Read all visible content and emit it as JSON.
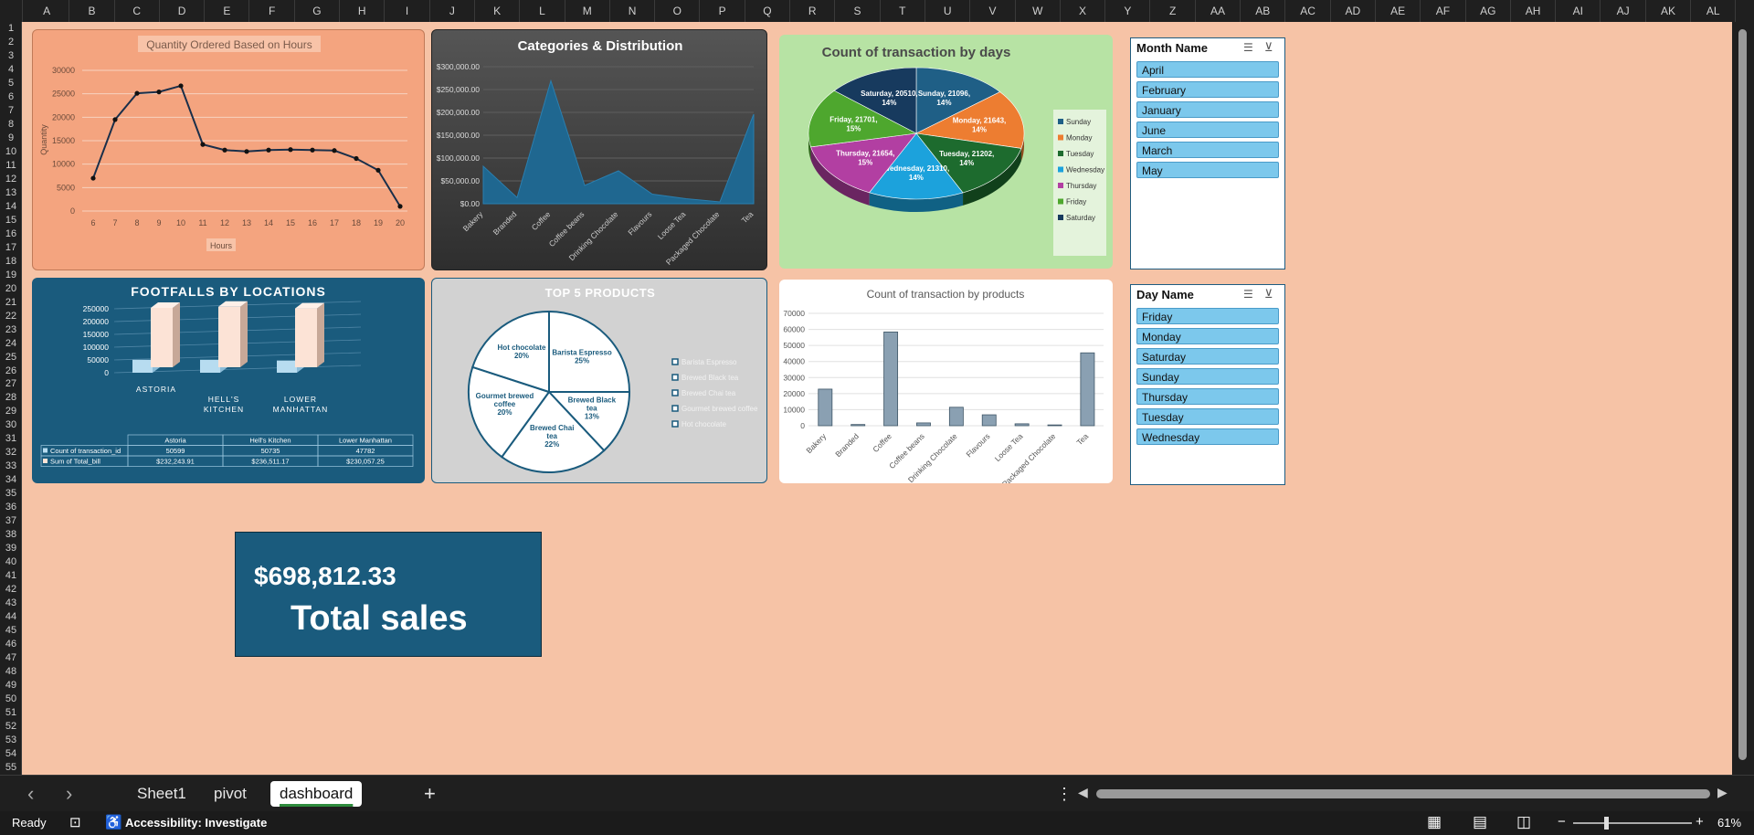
{
  "columns": [
    "A",
    "B",
    "C",
    "D",
    "E",
    "F",
    "G",
    "H",
    "I",
    "J",
    "K",
    "L",
    "M",
    "N",
    "O",
    "P",
    "Q",
    "R",
    "S",
    "T",
    "U",
    "V",
    "W",
    "X",
    "Y",
    "Z",
    "AA",
    "AB",
    "AC",
    "AD",
    "AE",
    "AF",
    "AG",
    "AH",
    "AI",
    "AJ",
    "AK",
    "AL"
  ],
  "rows": [
    "1",
    "2",
    "3",
    "4",
    "5",
    "6",
    "7",
    "8",
    "9",
    "10",
    "11",
    "12",
    "13",
    "14",
    "15",
    "16",
    "17",
    "18",
    "19",
    "20",
    "21",
    "22",
    "23",
    "24",
    "25",
    "26",
    "27",
    "28",
    "29",
    "30",
    "31",
    "32",
    "33",
    "34",
    "35",
    "36",
    "37",
    "38",
    "39",
    "40",
    "41",
    "42",
    "43",
    "44",
    "45",
    "46",
    "47",
    "48",
    "49",
    "50",
    "51",
    "52",
    "53",
    "54",
    "55"
  ],
  "tabs": {
    "prev": "‹",
    "next": "›",
    "sheet1": "Sheet1",
    "pivot": "pivot",
    "dashboard": "dashboard",
    "add": "+",
    "more": "⋮"
  },
  "status": {
    "ready": "Ready",
    "accessibility": "Accessibility: Investigate",
    "zoom": "61%",
    "zoom_minus": "−",
    "zoom_plus": "+"
  },
  "colors": {
    "peach_bg": "#f6c3a6",
    "blue_panel": "#1a5b7d",
    "dark_panel": "#3a3a3a",
    "green_panel": "#b7e3a4",
    "gray_panel": "#d2d2d2"
  },
  "month_slicer": {
    "title": "Month Name",
    "items": [
      "April",
      "February",
      "January",
      "June",
      "March",
      "May"
    ]
  },
  "day_slicer": {
    "title": "Day Name",
    "items": [
      "Friday",
      "Monday",
      "Saturday",
      "Sunday",
      "Thursday",
      "Tuesday",
      "Wednesday"
    ]
  },
  "kpi": {
    "value": "$698,812.33",
    "label": "Total sales"
  },
  "chart_data": [
    {
      "id": "hours",
      "type": "line",
      "title": "Quantity Ordered Based on Hours",
      "xlabel": "Hours",
      "ylabel": "Quantity",
      "x": [
        6,
        7,
        8,
        9,
        10,
        11,
        12,
        13,
        14,
        15,
        16,
        17,
        18,
        19,
        20
      ],
      "values": [
        7000,
        19500,
        25100,
        25400,
        26700,
        14200,
        13000,
        12700,
        13000,
        13100,
        13000,
        12900,
        11200,
        8700,
        1000
      ],
      "ylim": [
        0,
        30000
      ],
      "yticks": [
        "0",
        "5000",
        "10000",
        "15000",
        "20000",
        "25000",
        "30000"
      ],
      "grid": true
    },
    {
      "id": "categories",
      "type": "area",
      "title": "Categories & Distribution",
      "categories": [
        "Bakery",
        "Branded",
        "Coffee",
        "Coffee beans",
        "Drinking Chocolate",
        "Flavours",
        "Loose Tea",
        "Packaged Chocolate",
        "Tea"
      ],
      "values": [
        82000,
        13500,
        269000,
        40000,
        72000,
        21000,
        11000,
        4000,
        196000
      ],
      "ylim": [
        0,
        300000
      ],
      "yticks": [
        "$0.00",
        "$50,000.00",
        "$100,000.00",
        "$150,000.00",
        "$200,000.00",
        "$250,000.00",
        "$300,000.00"
      ],
      "grid": true
    },
    {
      "id": "days",
      "type": "pie",
      "title": "Count of transaction by days",
      "series": [
        {
          "name": "Sunday",
          "value": 21096,
          "label": "Sunday, 21096, 14%",
          "color": "#1f5f86"
        },
        {
          "name": "Monday",
          "value": 21643,
          "label": "Monday, 21643, 14%",
          "color": "#ed7d31"
        },
        {
          "name": "Tuesday",
          "value": 21202,
          "label": "Tuesday, 21202, 14%",
          "color": "#1d6b2e"
        },
        {
          "name": "Wednesday",
          "value": 21310,
          "label": "Wednesday, 21310, 14%",
          "color": "#1ca2dc"
        },
        {
          "name": "Thursday",
          "value": 21654,
          "label": "Thursday, 21654, 15%",
          "color": "#b23fa2"
        },
        {
          "name": "Friday",
          "value": 21701,
          "label": "Friday, 21701, 15%",
          "color": "#4ea72e"
        },
        {
          "name": "Saturday",
          "value": 20510,
          "label": "Saturday, 20510, 14%",
          "color": "#173a5e"
        }
      ],
      "legend": "right"
    },
    {
      "id": "footfalls",
      "type": "bar",
      "title": "FOOTFALLS BY LOCATIONS",
      "categories": [
        "ASTORIA",
        "HELL'S KITCHEN",
        "LOWER MANHATTAN"
      ],
      "series": [
        {
          "name": "Count of transaction_id",
          "values": [
            50599,
            50735,
            47782
          ]
        },
        {
          "name": "Sum of Total_bill",
          "values": [
            232243.91,
            236511.17,
            230057.25
          ]
        }
      ],
      "ylim": [
        0,
        250000
      ],
      "yticks": [
        "0",
        "50000",
        "100000",
        "150000",
        "200000",
        "250000"
      ],
      "table": {
        "headers": [
          "",
          "Astoria",
          "Hell's Kitchen",
          "Lower Manhattan"
        ],
        "rows": [
          [
            "Count of transaction_id",
            "50599",
            "50735",
            "47782"
          ],
          [
            "Sum of Total_bill",
            "$232,243.91",
            "$236,511.17",
            "$230,057.25"
          ]
        ]
      }
    },
    {
      "id": "top5",
      "type": "pie",
      "title": "TOP 5 PRODUCTS",
      "series": [
        {
          "name": "Barista Espresso",
          "value": 25,
          "label": "Barista Espresso 25%"
        },
        {
          "name": "Brewed Black tea",
          "value": 13,
          "label": "Brewed Black tea 13%"
        },
        {
          "name": "Brewed Chai tea",
          "value": 22,
          "label": "Brewed Chai tea 22%"
        },
        {
          "name": "Gourmet brewed coffee",
          "value": 20,
          "label": "Gourmet brewed coffee 20%"
        },
        {
          "name": "Hot chocolate",
          "value": 20,
          "label": "Hot chocolate 20%"
        }
      ],
      "legend": "right"
    },
    {
      "id": "products",
      "type": "bar",
      "title": "Count of transaction by products",
      "categories": [
        "Bakery",
        "Branded",
        "Coffee",
        "Coffee beans",
        "Drinking Chocolate",
        "Flavours",
        "Loose Tea",
        "Packaged Chocolate",
        "Tea"
      ],
      "values": [
        22800,
        750,
        58400,
        1750,
        11500,
        6800,
        1200,
        500,
        45400
      ],
      "ylim": [
        0,
        70000
      ],
      "yticks": [
        "0",
        "10000",
        "20000",
        "30000",
        "40000",
        "50000",
        "60000",
        "70000"
      ],
      "grid": true
    }
  ]
}
